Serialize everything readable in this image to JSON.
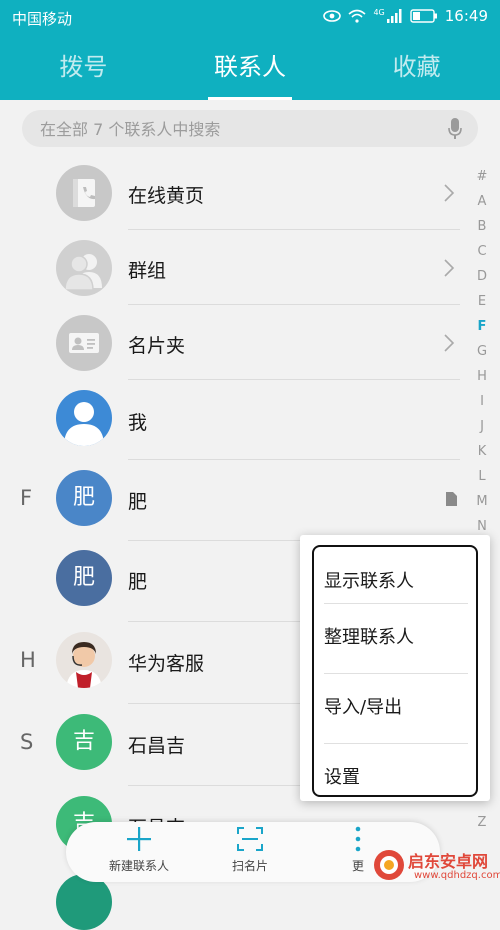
{
  "status_bar": {
    "carrier": "中国移动",
    "time": "16:49",
    "network": "4G"
  },
  "tabs": [
    {
      "label": "拨号"
    },
    {
      "label": "联系人"
    },
    {
      "label": "收藏"
    }
  ],
  "search": {
    "placeholder": "在全部 7 个联系人中搜索"
  },
  "contacts": [
    {
      "name": "在线黄页",
      "icon": "yellow-pages-icon"
    },
    {
      "name": "群组",
      "icon": "group-icon"
    },
    {
      "name": "名片夹",
      "icon": "business-card-icon"
    },
    {
      "name": "我",
      "icon": "person-icon"
    },
    {
      "letter": "F",
      "name": "肥",
      "avatar_text": "肥",
      "avatar_color": "#4a86c8",
      "sim": true
    },
    {
      "name": "肥",
      "avatar_text": "肥",
      "avatar_color": "#4a6ea0"
    },
    {
      "letter": "H",
      "name": "华为客服",
      "icon": "photo-avatar"
    },
    {
      "letter": "S",
      "name": "石昌吉",
      "avatar_text": "吉",
      "avatar_color": "#3dba78"
    },
    {
      "name": "石昌吉",
      "avatar_text": "吉",
      "avatar_color": "#3dba78"
    }
  ],
  "index_letters": [
    "#",
    "A",
    "B",
    "C",
    "D",
    "E",
    "F",
    "G",
    "H",
    "I",
    "J",
    "K",
    "L",
    "M",
    "N",
    "Z"
  ],
  "index_active": "F",
  "popup_menu": {
    "items": [
      "显示联系人",
      "整理联系人",
      "导入/导出",
      "设置"
    ]
  },
  "bottom_bar": {
    "new_contact": "新建联系人",
    "scan_card": "扫名片",
    "more": "更"
  },
  "watermark": {
    "title": "启东安卓网",
    "url": "www.qdhdzq.com"
  },
  "colors": {
    "accent": "#0fb0c0",
    "active_index": "#1aa5c9"
  }
}
